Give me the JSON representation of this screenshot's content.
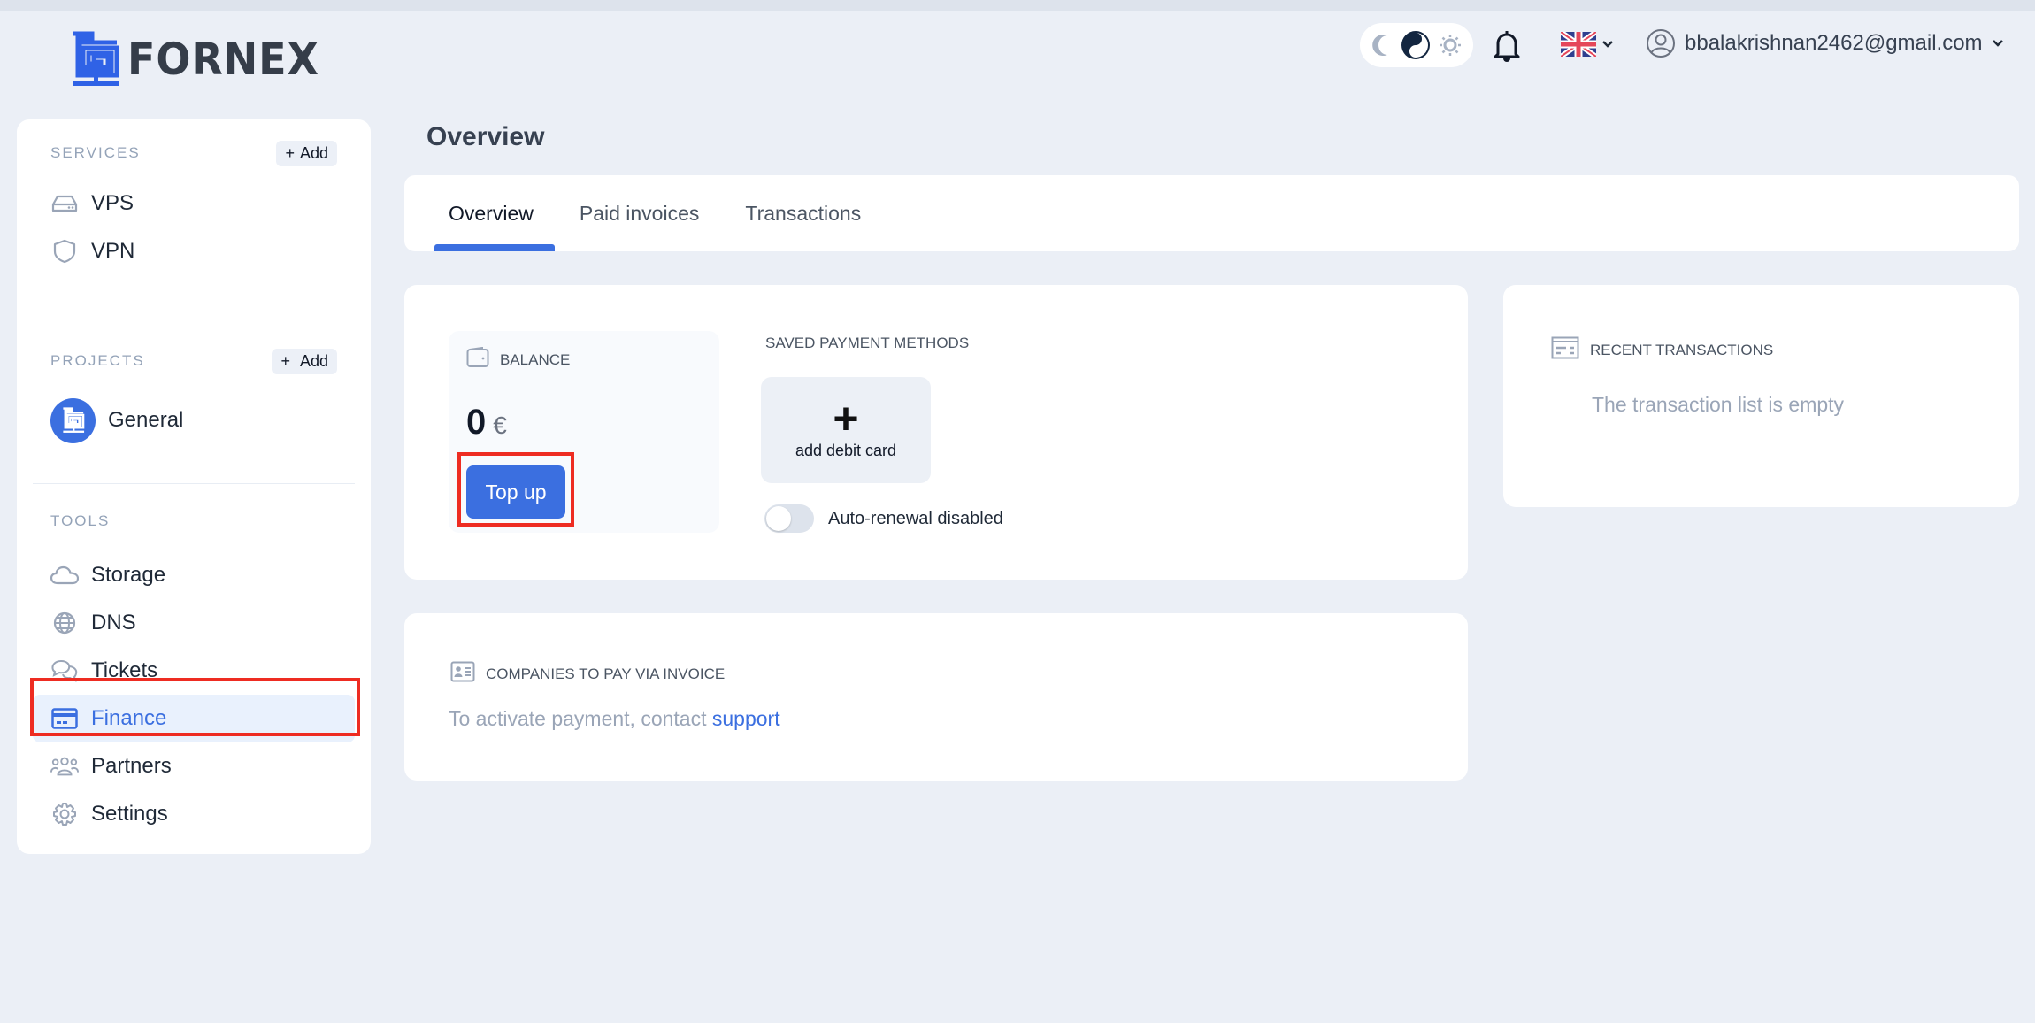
{
  "header": {
    "logo_text": "FORNEX",
    "theme_options": [
      "dark",
      "auto",
      "light"
    ],
    "theme_selected": "auto",
    "language": "English (UK)",
    "user_email": "bbalakrishnan2462@gmail.com"
  },
  "sidebar": {
    "services": {
      "title": "SERVICES",
      "add_label": "Add",
      "items": [
        {
          "label": "VPS",
          "icon": "server-icon"
        },
        {
          "label": "VPN",
          "icon": "shield-icon"
        }
      ]
    },
    "projects": {
      "title": "PROJECTS",
      "add_label": "Add",
      "items": [
        {
          "label": "General",
          "icon": "project-logo-icon"
        }
      ]
    },
    "tools": {
      "title": "TOOLS",
      "items": [
        {
          "label": "Storage",
          "icon": "cloud-icon"
        },
        {
          "label": "DNS",
          "icon": "globe-icon"
        },
        {
          "label": "Tickets",
          "icon": "chat-icon"
        },
        {
          "label": "Finance",
          "icon": "credit-card-icon",
          "active": true
        },
        {
          "label": "Partners",
          "icon": "users-icon"
        },
        {
          "label": "Settings",
          "icon": "gear-icon"
        }
      ]
    }
  },
  "main": {
    "page_title": "Overview",
    "tabs": [
      {
        "label": "Overview",
        "active": true
      },
      {
        "label": "Paid invoices"
      },
      {
        "label": "Transactions"
      }
    ],
    "balance": {
      "label": "BALANCE",
      "amount": "0",
      "currency": "€",
      "topup_label": "Top up"
    },
    "payment_methods": {
      "title": "SAVED PAYMENT METHODS",
      "add_card_plus": "+",
      "add_card_label": "add debit card",
      "auto_renewal_label": "Auto-renewal disabled",
      "auto_renewal_enabled": false
    },
    "recent_transactions": {
      "title": "RECENT TRANSACTIONS",
      "empty_text": "The transaction list is empty"
    },
    "invoice_companies": {
      "title": "COMPANIES TO PAY VIA INVOICE",
      "text": "To activate payment, contact ",
      "link_label": "support"
    }
  },
  "colors": {
    "accent": "#3b6fe0",
    "background": "#ebeff6",
    "highlight": "#ee2c22"
  }
}
